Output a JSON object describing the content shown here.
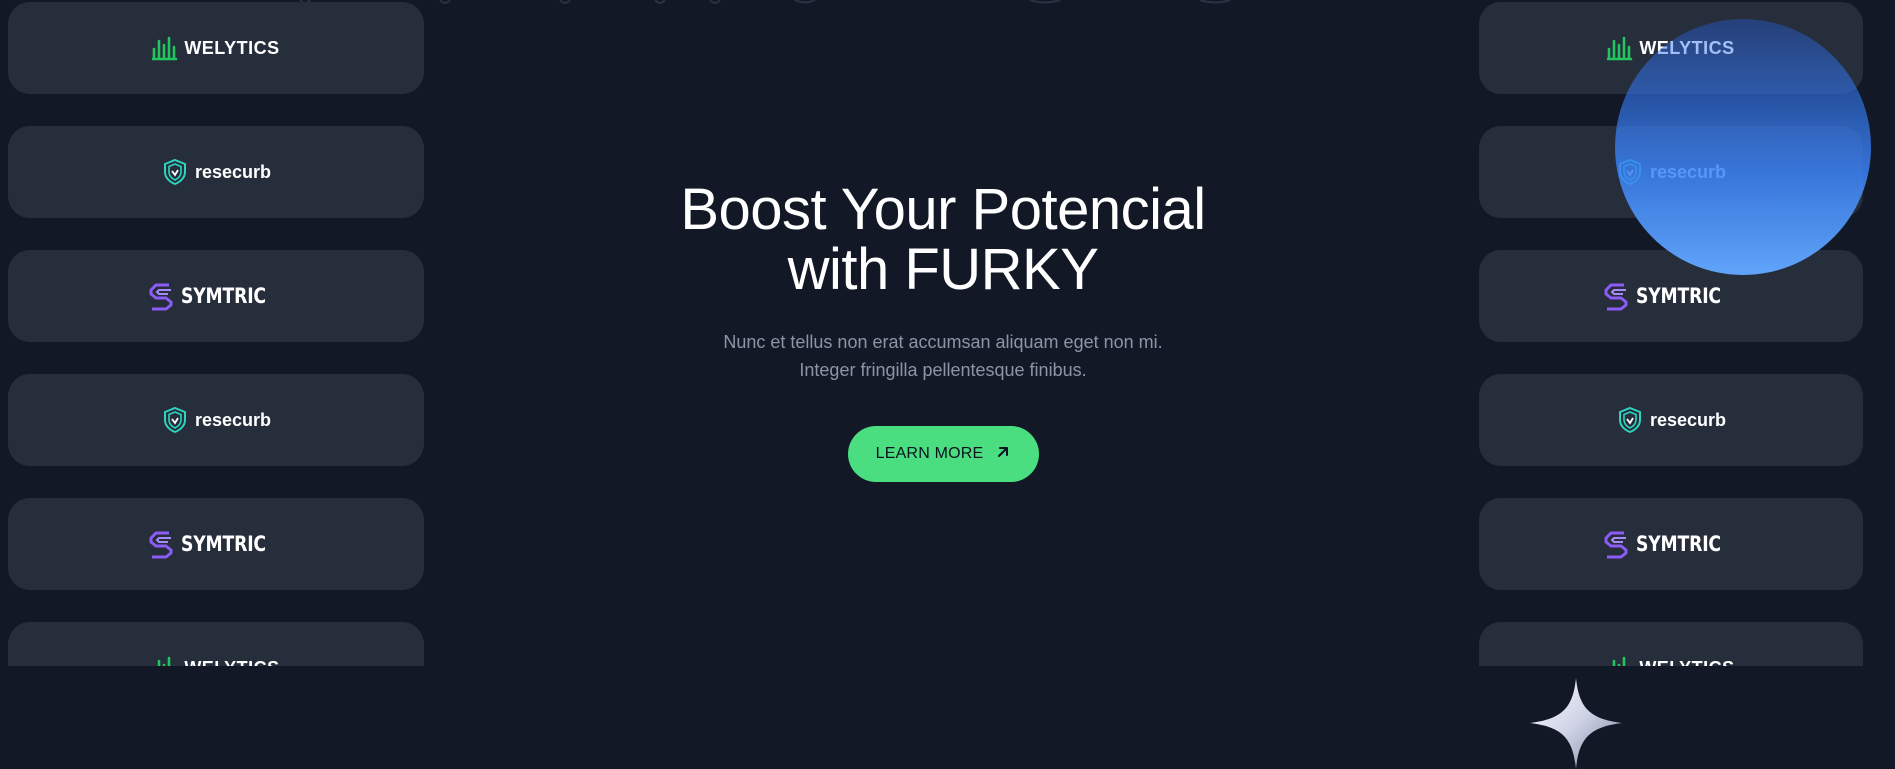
{
  "colors": {
    "background": "#121826",
    "card": "#262d3b",
    "accent_green": "#4ade80",
    "welytics_green": "#22c55e",
    "resecurb_teal": "#2dd4bf",
    "symtric_purple": "#8b5cf6",
    "orb_blue": "#3b82f6"
  },
  "logos": {
    "welytics": "WELYTICS",
    "resecurb": "resecurb",
    "symtric": "SYMTRIC"
  },
  "hero": {
    "title_line1": "Boost Your Potencial",
    "title_line2": "with FURKY",
    "subtitle_line1": "Nunc et tellus non erat accumsan aliquam eget non mi.",
    "subtitle_line2": "Integer fringilla pellentesque finibus.",
    "button_label": "LEARN MORE",
    "button_icon": "arrow-up-right-icon"
  },
  "decor": {
    "orb": "blue-gradient-orb",
    "sparkle": "four-point-star-icon"
  }
}
